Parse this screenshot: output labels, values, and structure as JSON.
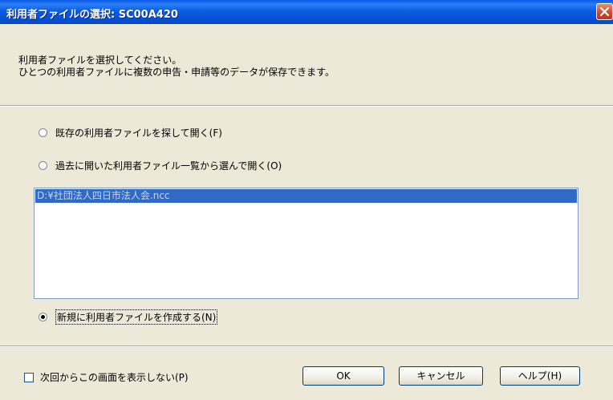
{
  "window": {
    "title": "利用者ファイルの選択: SC00A420"
  },
  "instructions": {
    "line1": "利用者ファイルを選択してください。",
    "line2": "ひとつの利用者ファイルに複数の申告・申請等のデータが保存できます。"
  },
  "options": [
    {
      "label": "既存の利用者ファイルを探して開く(F)",
      "checked": false
    },
    {
      "label": "過去に開いた利用者ファイル一覧から選んで開く(O)",
      "checked": false
    },
    {
      "label": "新規に利用者ファイルを作成する(N)",
      "checked": true
    }
  ],
  "recent_files": [
    "D:¥社団法人四日市法人会.ncc"
  ],
  "dont_show_again": {
    "label": "次回からこの画面を表示しない(P)",
    "checked": false
  },
  "buttons": {
    "ok": "OK",
    "cancel": "キャンセル",
    "help": "ヘルプ(H)"
  }
}
